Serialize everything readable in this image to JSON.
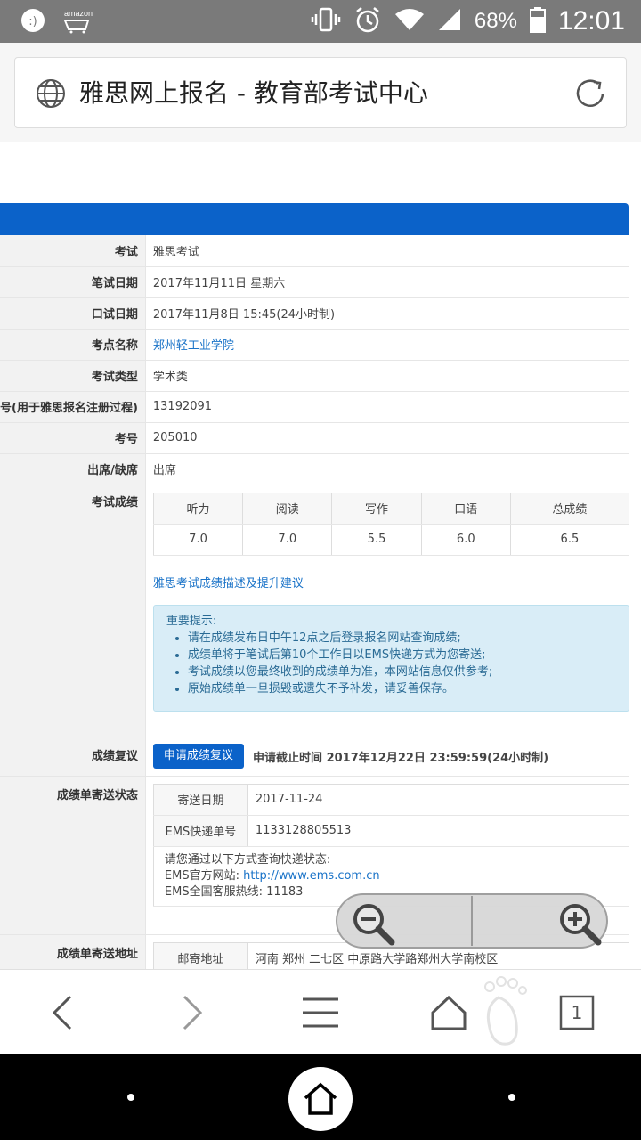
{
  "status": {
    "battery": "68%",
    "time": "12:01",
    "notif_app": "amazon"
  },
  "browser": {
    "tab_title": "雅思网上报名 - 教育部考试中心",
    "tab_count": "1"
  },
  "rows": [
    {
      "label": "考试",
      "value": "雅思考试"
    },
    {
      "label": "笔试日期",
      "value": "2017年11月11日 星期六"
    },
    {
      "label": "口试日期",
      "value": "2017年11月8日 15:45(24小时制)"
    },
    {
      "label": "考点名称",
      "value": "郑州轻工业学院"
    },
    {
      "label": "考试类型",
      "value": "学术类"
    },
    {
      "label": "号(用于雅思报名注册过程)",
      "value": "13192091"
    },
    {
      "label": "考号",
      "value": "205010"
    },
    {
      "label": "出席/缺席",
      "value": "出席"
    }
  ],
  "scores": {
    "label": "考试成绩",
    "headers": [
      "听力",
      "阅读",
      "写作",
      "口语",
      "总成绩"
    ],
    "values": [
      "7.0",
      "7.0",
      "5.5",
      "6.0",
      "6.5"
    ],
    "desc_link": "雅思考试成绩描述及提升建议",
    "tip_title": "重要提示:",
    "tips": [
      "请在成绩发布日中午12点之后登录报名网站查询成绩;",
      "成绩单将于笔试后第10个工作日以EMS快递方式为您寄送;",
      "考试成绩以您最终收到的成绩单为准，本网站信息仅供参考;",
      "原始成绩单一旦损毁或遗失不予补发，请妥善保存。"
    ]
  },
  "review": {
    "label": "成绩复议",
    "button": "申请成绩复议",
    "deadline": "申请截止时间 2017年12月22日 23:59:59(24小时制)"
  },
  "delivery": {
    "label": "成绩单寄送状态",
    "date_key": "寄送日期",
    "date_val": "2017-11-24",
    "ems_key": "EMS快递单号",
    "ems_val": "1133128805513",
    "note1": "请您通过以下方式查询快递状态:",
    "note2_prefix": "EMS官方网站: ",
    "note2_link": "http://www.ems.com.cn",
    "note3": "EMS全国客服热线: 11183"
  },
  "address": {
    "label": "成绩单寄送地址",
    "key": "邮寄地址",
    "value": "河南 郑州 二七区 中原路大学路郑州大学南校区"
  }
}
